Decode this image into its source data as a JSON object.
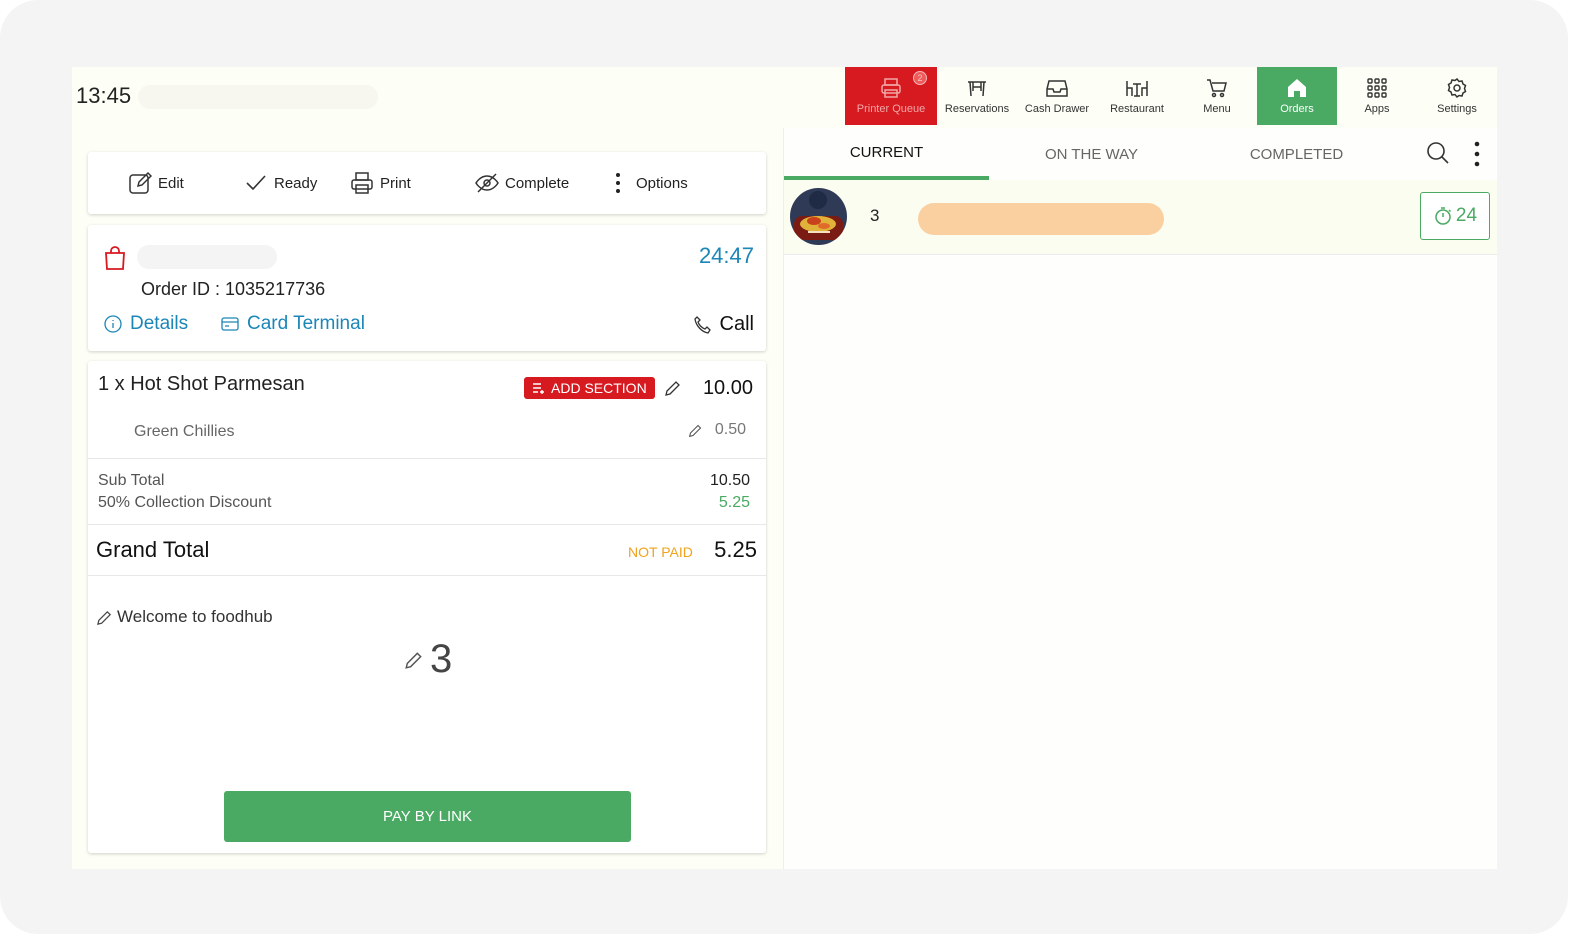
{
  "status_bar": {
    "time": "13:45"
  },
  "nav": {
    "printer_queue": {
      "label": "Printer Queue",
      "badge": "2"
    },
    "reservations": "Reservations",
    "cash_drawer": "Cash Drawer",
    "restaurant": "Restaurant",
    "menu": "Menu",
    "orders": "Orders",
    "apps": "Apps",
    "settings": "Settings"
  },
  "toolbar": {
    "edit": "Edit",
    "ready": "Ready",
    "print": "Print",
    "complete": "Complete",
    "options": "Options"
  },
  "order": {
    "timer": "24:47",
    "order_id": "Order ID : 1035217736",
    "details": "Details",
    "card_terminal": "Card Terminal",
    "call": "Call"
  },
  "items": [
    {
      "qty_name": "1 x  Hot Shot Parmesan",
      "add_section": "ADD SECTION",
      "price": "10.00",
      "modifiers": [
        {
          "name": "Green Chillies",
          "price": "0.50"
        }
      ]
    }
  ],
  "totals": {
    "sub_total_label": "Sub Total",
    "sub_total": "10.50",
    "discount_label": "50% Collection Discount",
    "discount": "5.25",
    "grand_total_label": "Grand Total",
    "payment_status": "NOT PAID",
    "grand_total": "5.25"
  },
  "note": "Welcome to foodhub",
  "covers": "3",
  "pay_button": "PAY BY LINK",
  "right_panel": {
    "tabs": [
      "CURRENT",
      "ON THE WAY",
      "COMPLETED"
    ],
    "active_tab": "CURRENT",
    "orders": [
      {
        "number": "3",
        "timer": "24"
      }
    ]
  },
  "colors": {
    "accent_green": "#4aaa63",
    "alert_red": "#d71920",
    "link_blue": "#1c86b8",
    "warning_orange": "#f0a31c",
    "name_pill": "#fbd0a0"
  }
}
